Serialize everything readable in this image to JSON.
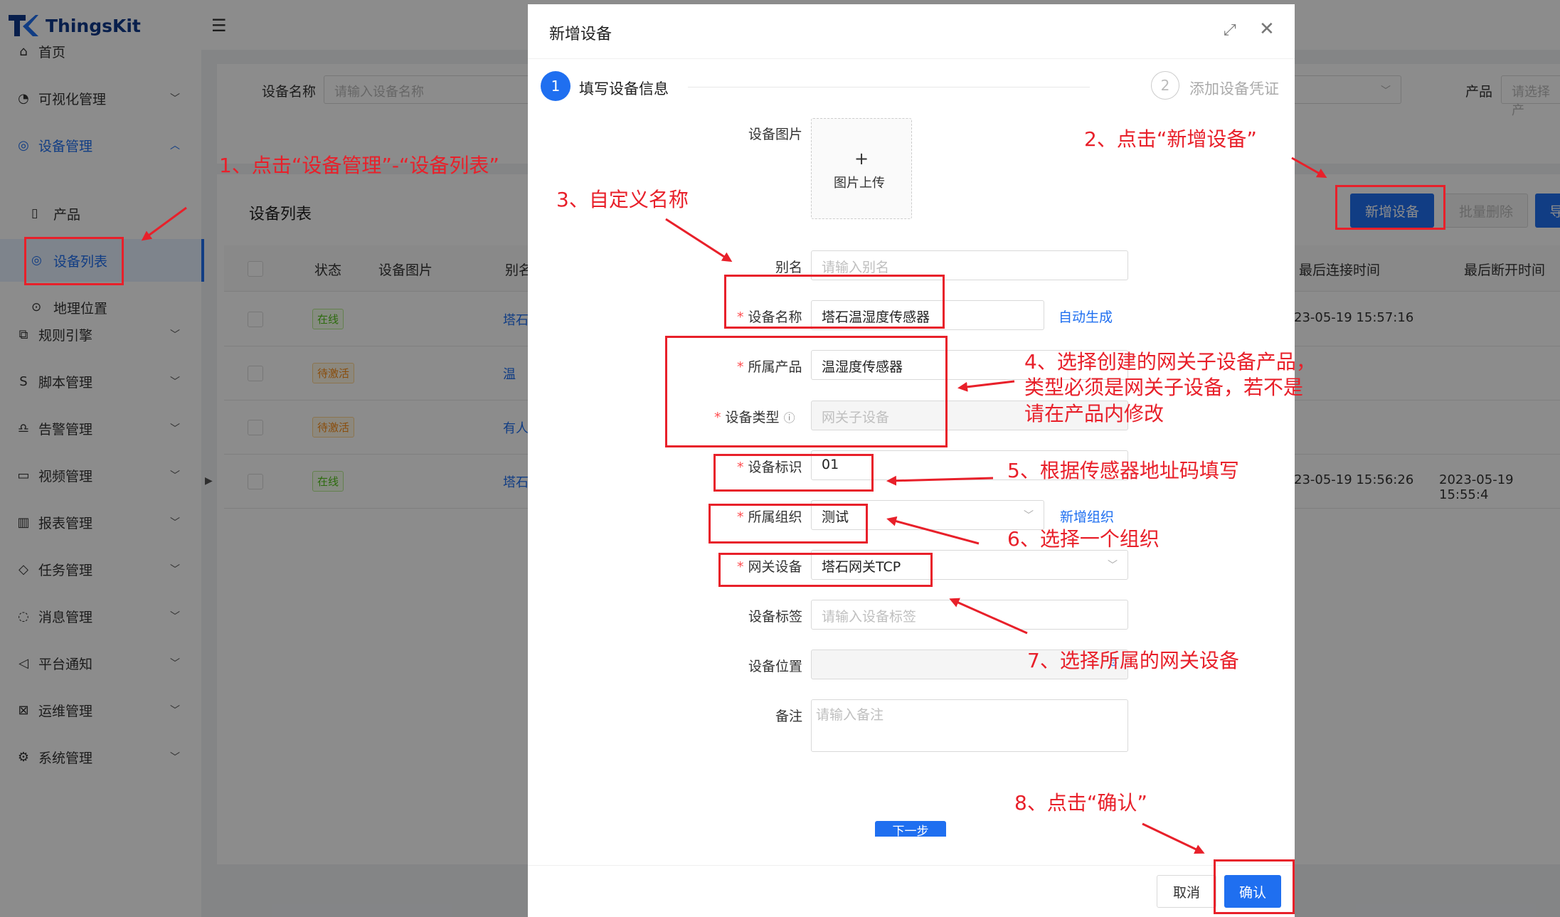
{
  "app": {
    "brand": "ThingsKit",
    "colors": {
      "primary": "#1f6ff0",
      "annotation": "#e8202a",
      "brand_text": "#0f3a8a"
    }
  },
  "sidebar": {
    "items": [
      {
        "label": "首页",
        "icon": "home-icon"
      },
      {
        "label": "可视化管理",
        "icon": "dashboard-icon"
      },
      {
        "label": "设备管理",
        "icon": "device-icon"
      },
      {
        "label": "规则引擎",
        "icon": "rule-icon"
      },
      {
        "label": "脚本管理",
        "icon": "script-icon"
      },
      {
        "label": "告警管理",
        "icon": "alarm-icon"
      },
      {
        "label": "视频管理",
        "icon": "video-icon"
      },
      {
        "label": "报表管理",
        "icon": "report-icon"
      },
      {
        "label": "任务管理",
        "icon": "task-icon"
      },
      {
        "label": "消息管理",
        "icon": "message-icon"
      },
      {
        "label": "平台通知",
        "icon": "notify-icon"
      },
      {
        "label": "运维管理",
        "icon": "ops-icon"
      },
      {
        "label": "系统管理",
        "icon": "system-icon"
      }
    ],
    "sub_items": [
      {
        "label": "产品",
        "icon": "product-icon"
      },
      {
        "label": "设备列表",
        "icon": "device-list-icon"
      },
      {
        "label": "地理位置",
        "icon": "location-icon"
      }
    ]
  },
  "search": {
    "device_name_label": "设备名称",
    "device_name_placeholder": "请输入设备名称",
    "product_label": "产品",
    "product_placeholder": "请选择产"
  },
  "table": {
    "title": "设备列表",
    "buttons": {
      "add": "新增设备",
      "batch_delete": "批量删除",
      "export": "导"
    },
    "headers": [
      "状态",
      "设备图片",
      "别名",
      "最后连接时间",
      "最后断开时间"
    ],
    "rows": [
      {
        "status": "在线",
        "status_type": "on",
        "alias": "塔石",
        "last_connect": "23-05-19 15:57:16",
        "last_disconnect": ""
      },
      {
        "status": "待激活",
        "status_type": "pending",
        "alias": "温",
        "last_connect": "",
        "last_disconnect": ""
      },
      {
        "status": "待激活",
        "status_type": "pending",
        "alias": "有人",
        "last_connect": "",
        "last_disconnect": ""
      },
      {
        "status": "在线",
        "status_type": "on",
        "alias": "塔石",
        "last_connect": "23-05-19 15:56:26",
        "last_disconnect": "2023-05-19 15:55:4"
      }
    ]
  },
  "modal": {
    "title": "新增设备",
    "steps": [
      {
        "num": "1",
        "label": "填写设备信息"
      },
      {
        "num": "2",
        "label": "添加设备凭证"
      }
    ],
    "form": {
      "image_label": "设备图片",
      "upload_plus": "+",
      "upload_text": "图片上传",
      "alias_label": "别名",
      "alias_placeholder": "请输入别名",
      "name_label": "设备名称",
      "name_value": "塔石温湿度传感器",
      "auto_generate": "自动生成",
      "product_label": "所属产品",
      "product_value": "温湿度传感器",
      "type_label": "设备类型",
      "type_value": "网关子设备",
      "id_label": "设备标识",
      "id_value": "01",
      "org_label": "所属组织",
      "org_value": "测试",
      "new_org": "新增组织",
      "gateway_label": "网关设备",
      "gateway_value": "塔石网关TCP",
      "tag_label": "设备标签",
      "tag_placeholder": "请输入设备标签",
      "location_label": "设备位置",
      "remark_label": "备注",
      "remark_placeholder": "请输入备注",
      "next_button": "下一步"
    },
    "footer": {
      "cancel": "取消",
      "confirm": "确认"
    }
  },
  "annotations": {
    "a1": "1、点击“设备管理”-“设备列表”",
    "a2": "2、点击“新增设备”",
    "a3": "3、自定义名称",
    "a4_line1": "4、选择创建的网关子设备产品，",
    "a4_line2": "类型必须是网关子设备，若不是",
    "a4_line3": "请在产品内修改",
    "a5": "5、根据传感器地址码填写",
    "a6": "6、选择一个组织",
    "a7": "7、选择所属的网关设备",
    "a8": "8、点击“确认”"
  }
}
